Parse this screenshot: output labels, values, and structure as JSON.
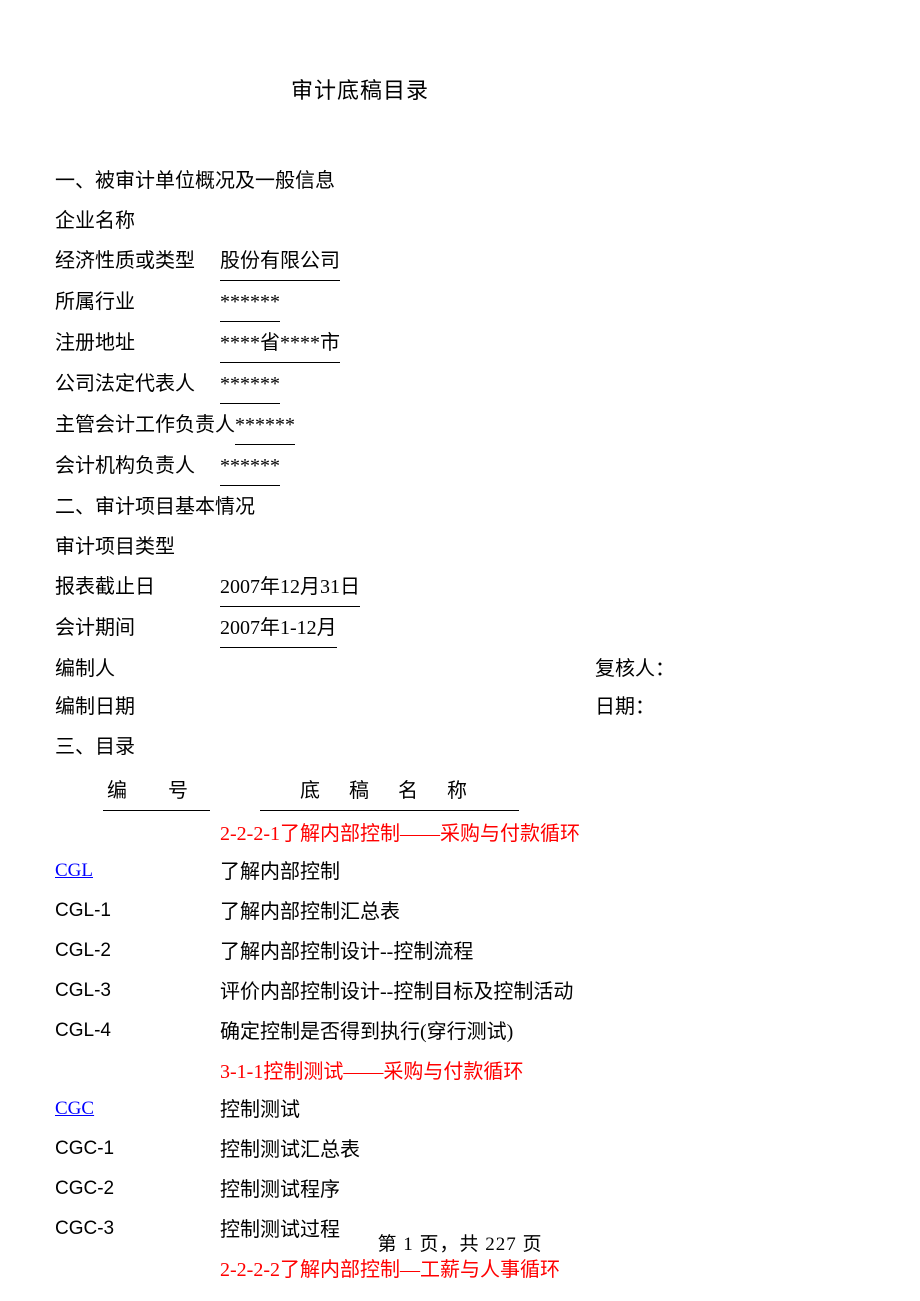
{
  "title": "审计底稿目录",
  "sec1": {
    "heading": "一、被审计单位概况及一般信息",
    "rows": {
      "company_label": "企业名称",
      "company_value": "",
      "econ_label": "经济性质或类型",
      "econ_value": "股份有限公司",
      "industry_label": "所属行业",
      "industry_value": "******",
      "addr_label": "注册地址",
      "addr_value": "****省****市",
      "legal_label": "公司法定代表人",
      "legal_value": "******",
      "acct_head_label": "主管会计工作负责人",
      "acct_head_value": "******",
      "acct_org_label": "会计机构负责人",
      "acct_org_value": "******"
    }
  },
  "sec2": {
    "heading": "二、审计项目基本情况",
    "rows": {
      "type_label": "审计项目类型",
      "type_value": "",
      "cutoff_label": "报表截止日",
      "cutoff_value": "2007年12月31日",
      "period_label": "会计期间",
      "period_value": "2007年1-12月",
      "prep_label": "编制人",
      "prep_value": "",
      "reviewer_label": "复核人：",
      "prep_date_label": "编制日期",
      "date_label": "日期："
    }
  },
  "sec3": {
    "heading": "三、目录",
    "col_code": "编 号",
    "col_name": "底 稿 名 称",
    "groups": {
      "g1": "2-2-2-1了解内部控制——采购与付款循环",
      "g2": "3-1-1控制测试——采购与付款循环",
      "g3": "2-2-2-2了解内部控制—工薪与人事循环"
    },
    "items": {
      "cgl": {
        "code": "CGL",
        "name": "了解内部控制"
      },
      "cgl1": {
        "code": "CGL-1",
        "name": "了解内部控制汇总表"
      },
      "cgl2": {
        "code": "CGL-2",
        "name": "了解内部控制设计--控制流程"
      },
      "cgl3": {
        "code": "CGL-3",
        "name": "评价内部控制设计--控制目标及控制活动"
      },
      "cgl4": {
        "code": "CGL-4",
        "name": "确定控制是否得到执行(穿行测试)"
      },
      "cgc": {
        "code": "CGC",
        "name": "控制测试"
      },
      "cgc1": {
        "code": "CGC-1",
        "name": "控制测试汇总表"
      },
      "cgc2": {
        "code": "CGC-2",
        "name": "控制测试程序"
      },
      "cgc3": {
        "code": "CGC-3",
        "name": "控制测试过程"
      }
    }
  },
  "footer": "第 1 页，共 227 页"
}
